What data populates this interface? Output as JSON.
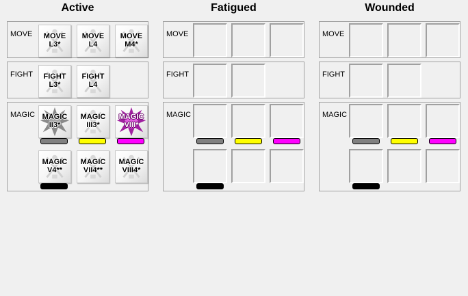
{
  "columns": {
    "active": {
      "title": "Active"
    },
    "fatigued": {
      "title": "Fatigued"
    },
    "wounded": {
      "title": "Wounded"
    }
  },
  "rows": {
    "move": "MOVE",
    "fight": "FIGHT",
    "magic": "MAGIC"
  },
  "chips": {
    "move_l3": "MOVE\nL3*",
    "move_l4": "MOVE\nL4",
    "move_m4": "MOVE\nM4*",
    "fight_l3": "FIGHT\nL3*",
    "fight_l4": "FIGHT\nL4",
    "magic_ii3": "MAGIC\nII3*",
    "magic_iii3": "MAGIC\nIII3*",
    "magic_viii": "MAGIC\nVIII*",
    "magic_v4": "MAGIC\nV4**",
    "magic_vii4": "MAGIC\nVII4**",
    "magic_viii4": "MAGIC\nVIII4*"
  },
  "chip_icons": {
    "default": "crossed-swords-icon",
    "magic_ii3": "gray-burst-icon",
    "magic_viii": "purple-burst-icon"
  },
  "colors": {
    "gray": "#808080",
    "yellow": "#ffff00",
    "magenta": "#ff00ff",
    "black": "#000000"
  }
}
